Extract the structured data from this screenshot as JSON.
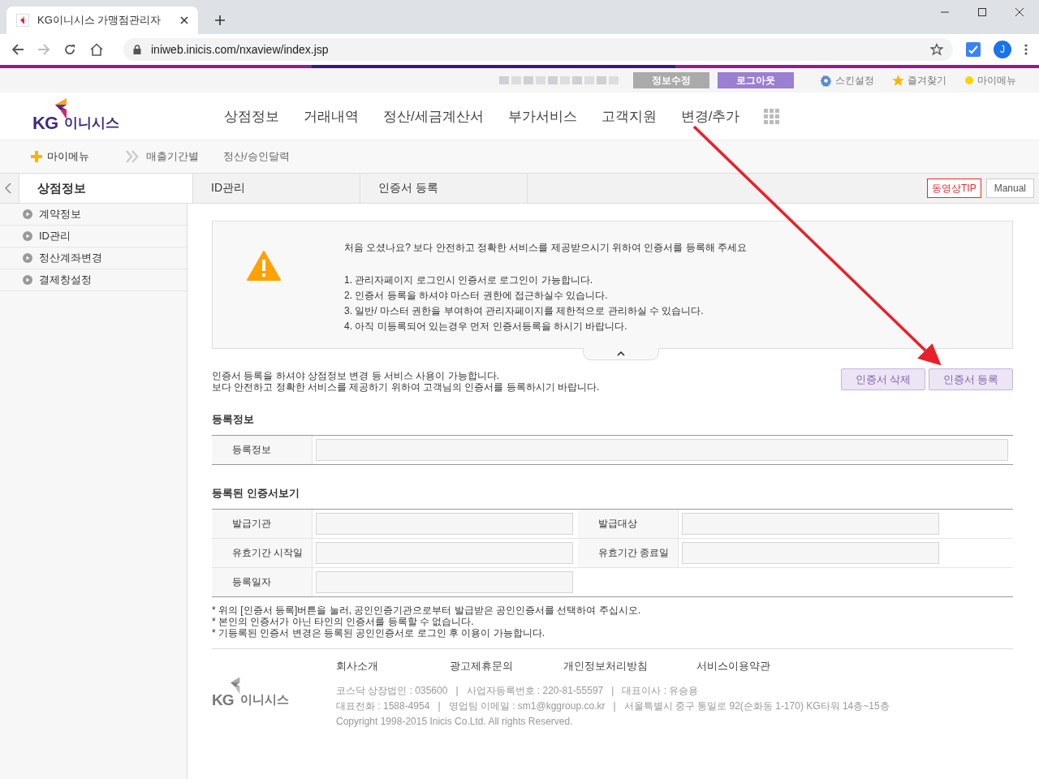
{
  "browser": {
    "tab_title": "KG이니시스 가맹점관리자",
    "url": "iniweb.inicis.com/nxaview/index.jsp",
    "avatar": "J"
  },
  "top_bar": {
    "buttons": [
      {
        "label": "정보수정",
        "kind": "grey"
      },
      {
        "label": "로그아웃",
        "kind": "purple"
      }
    ],
    "links": [
      {
        "label": "스킨설정",
        "kind": "gear"
      },
      {
        "label": "즐겨찾기",
        "kind": "star"
      },
      {
        "label": "마이메뉴",
        "kind": "dot"
      }
    ]
  },
  "logo": {
    "mark": "KG",
    "name": "이니시스"
  },
  "nav": [
    "상점정보",
    "거래내역",
    "정산/세금계산서",
    "부가서비스",
    "고객지원",
    "변경/추가"
  ],
  "my_menu": {
    "label": "마이메뉴",
    "links": [
      "매출기간별",
      "정산/승인달력"
    ]
  },
  "breadcrumb": {
    "items": [
      "상점정보",
      "ID관리",
      "인증서 등록"
    ],
    "tip": "동영상TIP",
    "manual": "Manual"
  },
  "sidebar": {
    "items": [
      "계약정보",
      "ID관리",
      "정산계좌변경",
      "결제창설정"
    ]
  },
  "notice": {
    "heading": "처음 오셨나요? 보다 안전하고 정확한 서비스를 제공받으시기 위하여 인증서를 등록해 주세요",
    "items": [
      "1. 관리자페이지 로그인시 인증서로 로그인이 가능합니다.",
      "2. 인증서 등록을 하셔야 마스터 권한에 접근하실수 있습니다.",
      "3. 일반/ 마스터 권한을 부여하여 관리자페이지를 제한적으로 관리하실 수 있습니다.",
      "4. 아직 미등록되어 있는경우 먼저 인증서등록을 하시기 바랍니다."
    ],
    "expanded": true
  },
  "intro": [
    "인증서 등록을 하셔야 상점정보 변경 등 서비스 사용이 가능합니다.",
    "보다 안전하고 정확한 서비스를 제공하기 위하여 고객님의 인증서를 등록하시기 바랍니다."
  ],
  "actions": [
    "인증서 삭제",
    "인증서 등록"
  ],
  "registration": {
    "title": "등록정보",
    "fields": [
      "등록정보"
    ]
  },
  "certificate": {
    "title": "등록된 인증서보기",
    "rows": [
      [
        "발급기관",
        "발급대상"
      ],
      [
        "유효기간 시작일",
        "유효기간 종료일"
      ],
      [
        "등록일자"
      ]
    ]
  },
  "notes": [
    "* 위의 [인증서 등록]버튼을 눌러, 공인인증기관으로부터 발급받은 공인인증서를 선택하여 주십시오.",
    "* 본인의 인증서가 아닌 타인의 인증서를 등록할 수 없습니다.",
    "* 기등록된 인증서 변경은 등록된 공인인증서로 로그인 후 이용이 가능합니다."
  ],
  "footer": {
    "logo": {
      "mark": "KG",
      "name": "이니시스"
    },
    "links": [
      "회사소개",
      "광고제휴문의",
      "개인정보처리방침",
      "서비스이용약관"
    ],
    "info": [
      "코스닥 상장법인 : 035600   |   사업자등록번호 : 220-81-55597   |   대표이사 : 유승용",
      "대표전화 : 1588-4954   |   영업팀 이메일 : sm1@kggroup.co.kr   |   서울특별시 중구 통일로 92(순화동 1-170) KG타워 14층~15층",
      "Copyright 1998-2015 Inicis Co.Ltd. All rights Reserved."
    ]
  }
}
